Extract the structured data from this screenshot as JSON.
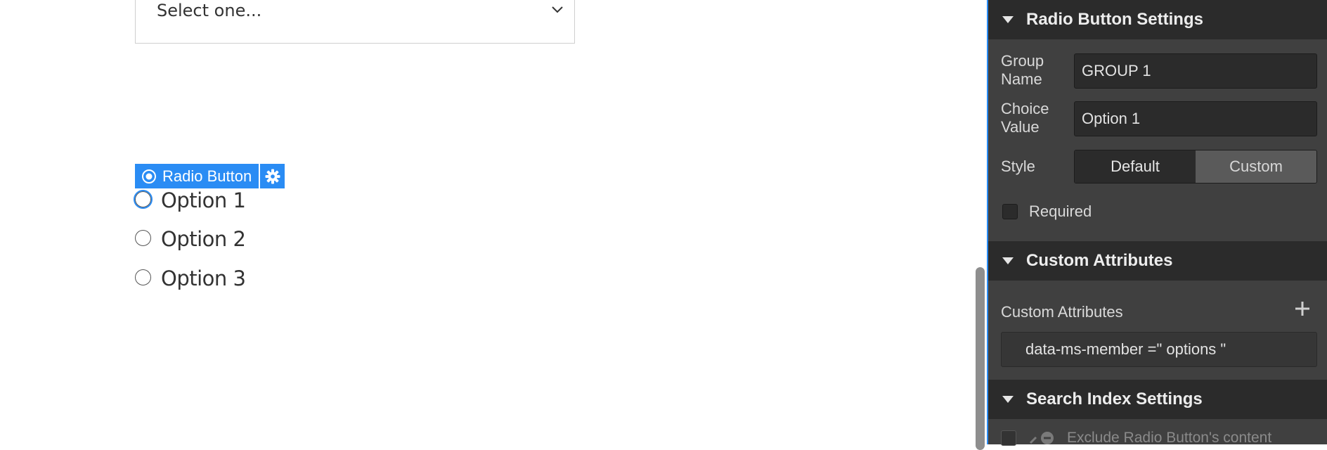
{
  "canvas": {
    "select": {
      "placeholder": "Select one..."
    },
    "element_badge": {
      "label": "Radio Button"
    },
    "radios": [
      {
        "label": "Option 1",
        "selected": true
      },
      {
        "label": "Option 2",
        "selected": false
      },
      {
        "label": "Option 3",
        "selected": false
      }
    ]
  },
  "panel": {
    "radio_settings": {
      "title": "Radio Button Settings",
      "group_name_label": "Group Name",
      "group_name_value": "GROUP 1",
      "choice_value_label": "Choice Value",
      "choice_value_value": "Option 1",
      "style_label": "Style",
      "style_options": [
        "Default",
        "Custom"
      ],
      "style_selected": "Default",
      "required_label": "Required",
      "required_checked": false
    },
    "custom_attributes": {
      "title": "Custom Attributes",
      "list_label": "Custom Attributes",
      "items": [
        "data-ms-member =\" options \""
      ]
    },
    "search_index": {
      "title": "Search Index Settings",
      "exclude_label": "Exclude Radio Button's content"
    }
  },
  "colors": {
    "accent": "#2a8cf4",
    "panel_bg": "#404040",
    "section_header_bg": "#2b2b2b"
  }
}
